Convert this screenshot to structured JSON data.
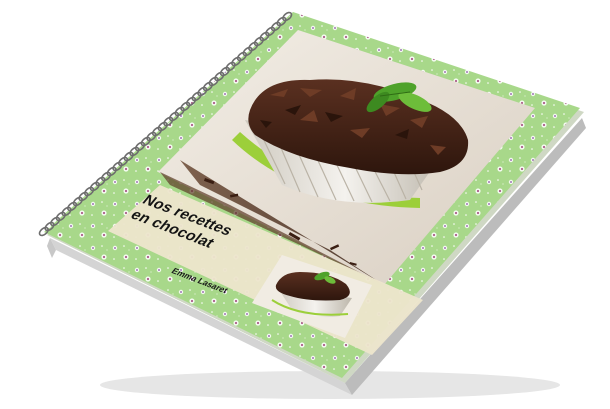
{
  "book": {
    "title_line1": "Nos recettes",
    "title_line2": "en chocolat",
    "author": "Emma Lasaret"
  },
  "colors": {
    "cover_green": "#a8d88a",
    "panel_beige": "#ece5cc",
    "chocolate": "#4a2618",
    "wrapper": "#e9e6df",
    "ribbon": "#9ccf3a",
    "mint": "#4ea22a",
    "spiral": "#7a7a7a"
  },
  "icons": {
    "floral_pattern": "flower-icon",
    "binding": "spiral-binding-icon"
  }
}
